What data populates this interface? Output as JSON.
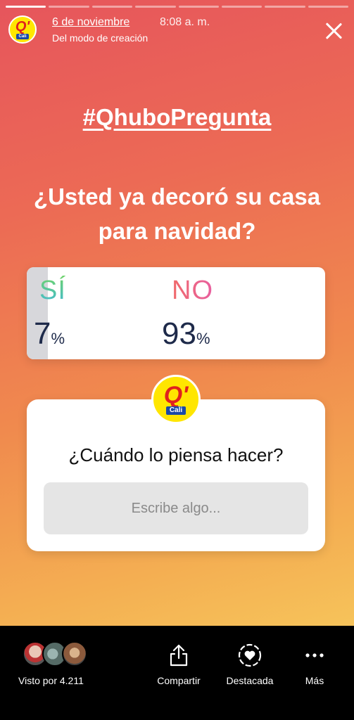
{
  "story": {
    "progress_segments": 8,
    "progress_done": 1,
    "account": {
      "logo_letter": "Q'",
      "logo_sub": "Cali"
    },
    "date": "6 de noviembre",
    "time": "8:08 a. m.",
    "subtitle": "Del modo de creación",
    "hashtag": "#QhuboPregunta",
    "question": "¿Usted ya decoró su casa para navidad?",
    "poll": {
      "options": [
        {
          "label": "SÍ",
          "percent_num": "7",
          "percent_sym": "%",
          "value": 7
        },
        {
          "label": "NO",
          "percent_num": "93",
          "percent_sym": "%",
          "value": 93
        }
      ]
    },
    "question_sticker": {
      "logo_letter": "Q'",
      "logo_sub": "Cali",
      "prompt": "¿Cuándo lo piensa hacer?",
      "placeholder": "Escribe algo..."
    }
  },
  "bottom_bar": {
    "seen_by": "Visto por 4.211",
    "actions": {
      "share": "Compartir",
      "highlight": "Destacada",
      "more": "Más"
    }
  },
  "colors": {
    "gradient_top": "#e6555c",
    "gradient_bottom": "#f6c35a",
    "logo_yellow": "#ffe600",
    "logo_red": "#e0211d",
    "percent_text": "#1e2a4a"
  }
}
